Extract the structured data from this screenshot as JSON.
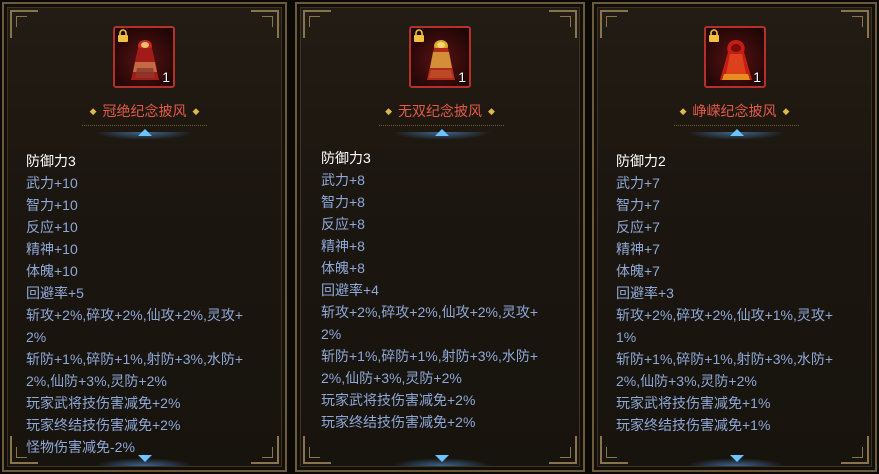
{
  "panels": [
    {
      "item_name": "冠绝纪念披风",
      "quantity": "1",
      "base_stat": "防御力3",
      "attributes": [
        "武力+10",
        "智力+10",
        "反应+10",
        "精神+10",
        "体魄+10",
        "回避率+5"
      ],
      "multi_lines": [
        [
          "斩攻+2%,碎攻+2%,仙攻+2%,灵攻+",
          "2%"
        ],
        [
          "斩防+1%,碎防+1%,射防+3%,水防+",
          "2%,仙防+3%,灵防+2%"
        ]
      ],
      "extra_lines": [
        "玩家武将技伤害减免+2%",
        "玩家终结技伤害减免+2%",
        "怪物伤害减免-2%"
      ]
    },
    {
      "item_name": "无双纪念披风",
      "quantity": "1",
      "base_stat": "防御力3",
      "attributes": [
        "武力+8",
        "智力+8",
        "反应+8",
        "精神+8",
        "体魄+8",
        "回避率+4"
      ],
      "multi_lines": [
        [
          "斩攻+2%,碎攻+2%,仙攻+2%,灵攻+",
          "2%"
        ],
        [
          "斩防+1%,碎防+1%,射防+3%,水防+",
          "2%,仙防+3%,灵防+2%"
        ]
      ],
      "extra_lines": [
        "玩家武将技伤害减免+2%",
        "玩家终结技伤害减免+2%"
      ]
    },
    {
      "item_name": "峥嵘纪念披风",
      "quantity": "1",
      "base_stat": "防御力2",
      "attributes": [
        "武力+7",
        "智力+7",
        "反应+7",
        "精神+7",
        "体魄+7",
        "回避率+3"
      ],
      "multi_lines": [
        [
          "斩攻+2%,碎攻+2%,仙攻+1%,灵攻+",
          "1%"
        ],
        [
          "斩防+1%,碎防+1%,射防+3%,水防+",
          "2%,仙防+3%,灵防+2%"
        ]
      ],
      "extra_lines": [
        "玩家武将技伤害减免+1%",
        "玩家终结技伤害减免+1%"
      ]
    }
  ],
  "icons": [
    "lock-icon",
    "cloak-icon",
    "diamond-icon",
    "arrow-up-icon",
    "arrow-down-icon"
  ],
  "colors": {
    "name": "#e45a4a",
    "base_stat": "#ffffff",
    "attribute": "#8fa8d8",
    "border": "#6d5a3b",
    "icon_border": "#b4302a",
    "diamond": "#e0b84a",
    "arrow": "#6cc4ff"
  }
}
